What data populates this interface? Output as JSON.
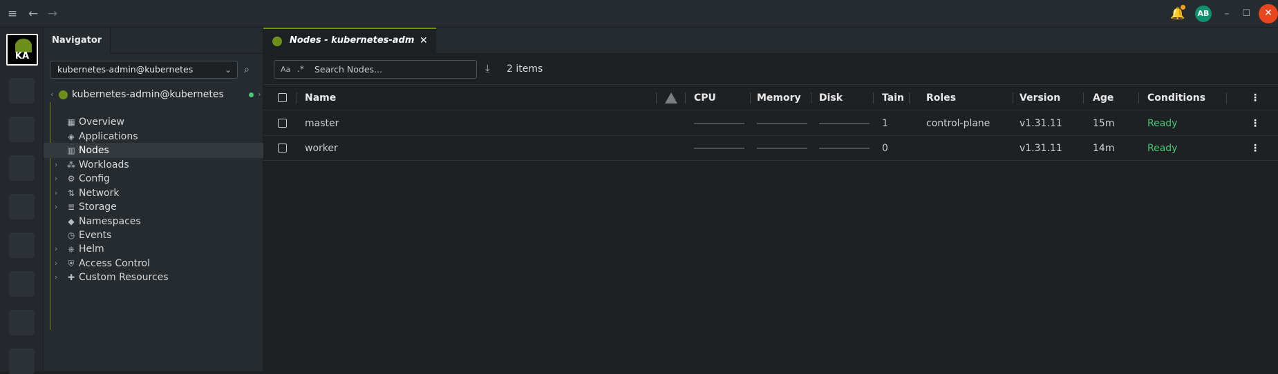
{
  "topbar": {
    "menu_icon": "menu-icon",
    "back_icon": "arrow-left-icon",
    "forward_icon": "arrow-right-icon",
    "avatar_initials": "AB",
    "avatar_color": "#0e8f6e",
    "notification_dot_color": "#f0a020",
    "close_color": "#e8461e"
  },
  "hotbar": {
    "cluster_abbr": "KA"
  },
  "sidebar": {
    "tab_label": "Navigator",
    "cluster_select": "kubernetes-admin@kubernetes",
    "tree_root": "kubernetes-admin@kubernetes",
    "items": [
      {
        "label": "Overview",
        "icon": "grid-icon",
        "expandable": false,
        "active": false
      },
      {
        "label": "Applications",
        "icon": "layers-icon",
        "expandable": false,
        "active": false
      },
      {
        "label": "Nodes",
        "icon": "nodes-icon",
        "expandable": false,
        "active": true
      },
      {
        "label": "Workloads",
        "icon": "workloads-icon",
        "expandable": true,
        "active": false
      },
      {
        "label": "Config",
        "icon": "config-icon",
        "expandable": true,
        "active": false
      },
      {
        "label": "Network",
        "icon": "network-icon",
        "expandable": true,
        "active": false
      },
      {
        "label": "Storage",
        "icon": "storage-icon",
        "expandable": true,
        "active": false
      },
      {
        "label": "Namespaces",
        "icon": "namespaces-icon",
        "expandable": false,
        "active": false
      },
      {
        "label": "Events",
        "icon": "clock-icon",
        "expandable": false,
        "active": false
      },
      {
        "label": "Helm",
        "icon": "helm-icon",
        "expandable": true,
        "active": false
      },
      {
        "label": "Access Control",
        "icon": "shield-icon",
        "expandable": true,
        "active": false
      },
      {
        "label": "Custom Resources",
        "icon": "puzzle-icon",
        "expandable": true,
        "active": false
      }
    ]
  },
  "main": {
    "tab_label": "Nodes - kubernetes-admin@...",
    "search": {
      "aa_label": "Aa",
      "regex_label": ".*",
      "placeholder": "Search Nodes..."
    },
    "items_count": "2 items",
    "table": {
      "headers": {
        "name": "Name",
        "cpu": "CPU",
        "memory": "Memory",
        "disk": "Disk",
        "taints": "Taints",
        "roles": "Roles",
        "version": "Version",
        "age": "Age",
        "conditions": "Conditions"
      },
      "rows": [
        {
          "name": "master",
          "taints": "1",
          "roles": "control-plane",
          "version": "v1.31.11",
          "age": "15m",
          "conditions": "Ready"
        },
        {
          "name": "worker",
          "taints": "0",
          "roles": "",
          "version": "v1.31.11",
          "age": "14m",
          "conditions": "Ready"
        }
      ]
    }
  },
  "colors": {
    "accent": "#6b8f1a",
    "ready": "#48c774"
  }
}
